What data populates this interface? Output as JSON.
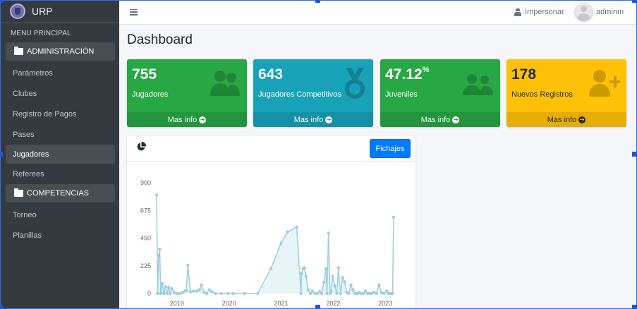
{
  "brand": {
    "name": "URP"
  },
  "sidebar": {
    "header": "MENU PRINCIPAL",
    "sections": [
      {
        "label": "ADMINISTRACIÓN",
        "items": [
          "Parámetros",
          "Clubes",
          "Registro de Pagos",
          "Pases",
          "Jugadores",
          "Referees"
        ]
      },
      {
        "label": "COMPETENCIAS",
        "items": [
          "Torneo",
          "Planillas"
        ]
      }
    ],
    "active_item": "Jugadores"
  },
  "topbar": {
    "impersonate_label": "Impersonar",
    "username": "adminm"
  },
  "page": {
    "title": "Dashboard"
  },
  "stats": [
    {
      "value": "755",
      "suffix": "",
      "label": "Jugadores",
      "footer": "Mas info",
      "color": "#28a745",
      "icon": "users-icon"
    },
    {
      "value": "643",
      "suffix": "",
      "label": "Jugadores Competitivos",
      "footer": "Mas info",
      "color": "#17a2b8",
      "icon": "medal-icon"
    },
    {
      "value": "47.12",
      "suffix": "%",
      "label": "Juveniles",
      "footer": "Mas info",
      "color": "#28a745",
      "icon": "user-friends-icon"
    },
    {
      "value": "178",
      "suffix": "",
      "label": "Nuevos Registros",
      "footer": "Mas info",
      "color": "#ffc107",
      "icon": "user-plus-icon"
    }
  ],
  "chart_card": {
    "icon": "chart-pie-icon",
    "button_label": "Fichajes"
  },
  "chart_data": {
    "type": "area",
    "title": "",
    "xlabel": "",
    "ylabel": "",
    "yticks": [
      0,
      225,
      450,
      675,
      900
    ],
    "ylim": [
      0,
      900
    ],
    "xticks": [
      "2019",
      "2020",
      "2021",
      "2022",
      "2023"
    ],
    "xlim": [
      2018.61,
      2023.16
    ],
    "grid": false,
    "legend": "none",
    "color": "#9ccee0",
    "series": [
      {
        "x": [
          2018.61,
          2018.63,
          2018.65,
          2018.67,
          2018.69,
          2018.72,
          2018.75,
          2018.78,
          2018.81,
          2018.84,
          2018.87,
          2018.9,
          2018.95,
          2019.0,
          2019.05,
          2019.1,
          2019.15,
          2019.18,
          2019.21,
          2019.26,
          2019.32,
          2019.38,
          2019.43,
          2019.47,
          2019.52,
          2019.57,
          2019.62,
          2019.67,
          2019.74,
          2019.85,
          2019.98,
          2020.08,
          2020.3,
          2020.55,
          2020.8,
          2021.0,
          2021.12,
          2021.3,
          2021.38,
          2021.39,
          2021.42,
          2021.45,
          2021.48,
          2021.52,
          2021.56,
          2021.6,
          2021.65,
          2021.7,
          2021.74,
          2021.78,
          2021.82,
          2021.86,
          2021.88,
          2021.91,
          2021.94,
          2021.96,
          2021.99,
          2022.03,
          2022.07,
          2022.1,
          2022.14,
          2022.18,
          2022.22,
          2022.26,
          2022.3,
          2022.34,
          2022.38,
          2022.42,
          2022.46,
          2022.5,
          2022.54,
          2022.58,
          2022.62,
          2022.66,
          2022.7,
          2022.74,
          2022.78,
          2022.83,
          2022.88,
          2022.93,
          2022.98,
          2023.03,
          2023.06,
          2023.08,
          2023.1,
          2023.12,
          2023.14,
          2023.16
        ],
        "y": [
          800,
          0,
          310,
          360,
          0,
          80,
          0,
          55,
          0,
          50,
          0,
          40,
          5,
          0,
          0,
          5,
          20,
          25,
          230,
          15,
          20,
          20,
          30,
          70,
          10,
          0,
          30,
          15,
          0,
          0,
          0,
          0,
          0,
          0,
          200,
          410,
          500,
          540,
          0,
          160,
          200,
          210,
          140,
          30,
          0,
          20,
          0,
          0,
          15,
          0,
          90,
          200,
          0,
          490,
          0,
          20,
          140,
          60,
          0,
          210,
          0,
          130,
          95,
          10,
          0,
          70,
          30,
          0,
          0,
          5,
          0,
          0,
          20,
          0,
          0,
          0,
          10,
          0,
          70,
          5,
          0,
          20,
          0,
          0,
          0,
          0,
          0,
          620
        ]
      }
    ]
  }
}
